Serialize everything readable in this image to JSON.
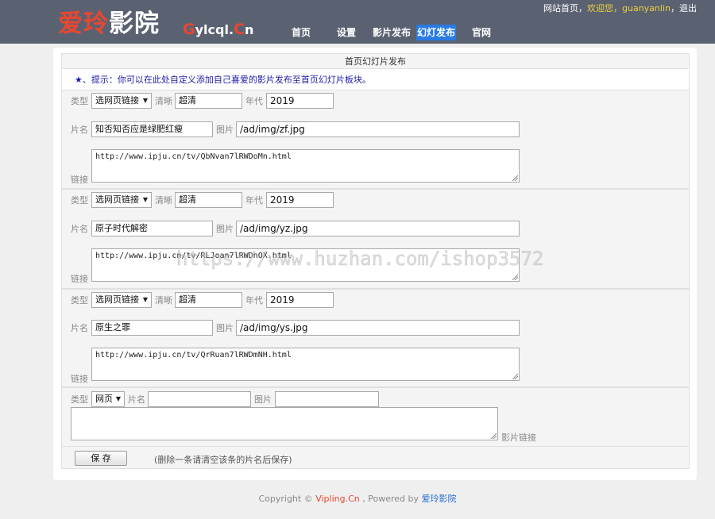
{
  "header": {
    "logo_red": "爱玲",
    "logo_white": "影院",
    "domain_g": "G",
    "domain_mid": "ylcql.",
    "domain_c": "C",
    "domain_end": "n",
    "nav": [
      {
        "label": "首页"
      },
      {
        "label": "设置"
      },
      {
        "label": "影片发布"
      },
      {
        "label": "幻灯发布"
      },
      {
        "label": "官网"
      }
    ],
    "userbar": {
      "home": "网站首页",
      "sep": "，",
      "welcome": "欢迎您，",
      "username": "guanyanlin",
      "sep2": "，",
      "logout": "退出"
    }
  },
  "panel": {
    "title": "首页幻灯片发布",
    "tip": "★、提示：你可以在此处自定义添加自己喜爱的影片发布至首页幻灯片板块。"
  },
  "labels": {
    "type": "类型",
    "clarity": "清晰",
    "year": "年代",
    "name": "片名",
    "image": "图片",
    "link": "链接",
    "movie_link": "影片链接"
  },
  "entries": [
    {
      "type": "选网页链接",
      "clarity": "超清",
      "year": "2019",
      "name": "知否知否应是绿肥红瘦",
      "image": "/ad/img/zf.jpg",
      "link": "http://www.ipju.cn/tv/QbNvan7lRWDoMn.html"
    },
    {
      "type": "选网页链接",
      "clarity": "超清",
      "year": "2019",
      "name": "原子时代解密",
      "image": "/ad/img/yz.jpg",
      "link": "http://www.ipju.cn/tv/RLJoan7lRWDnOX.html"
    },
    {
      "type": "选网页链接",
      "clarity": "超清",
      "year": "2019",
      "name": "原生之罪",
      "image": "/ad/img/ys.jpg",
      "link": "http://www.ipju.cn/tv/QrRuan7lRWDmNH.html"
    }
  ],
  "new_entry": {
    "type": "网页",
    "name": "",
    "image": "",
    "link": ""
  },
  "save": {
    "label": "保 存",
    "note": "(删除一条请清空该条的片名后保存)"
  },
  "footer": {
    "copyright": "Copyright © ",
    "site": "Vipling.Cn",
    "powered": " , Powered by ",
    "brand": "爱玲影院"
  },
  "watermark": "https://www.huzhan.com/ishop3572",
  "colors": {
    "header_bg": "#5a6272",
    "accent_red": "#e8472f",
    "nav_active": "#2a7be4",
    "tip_blue": "#1a1aa8"
  }
}
